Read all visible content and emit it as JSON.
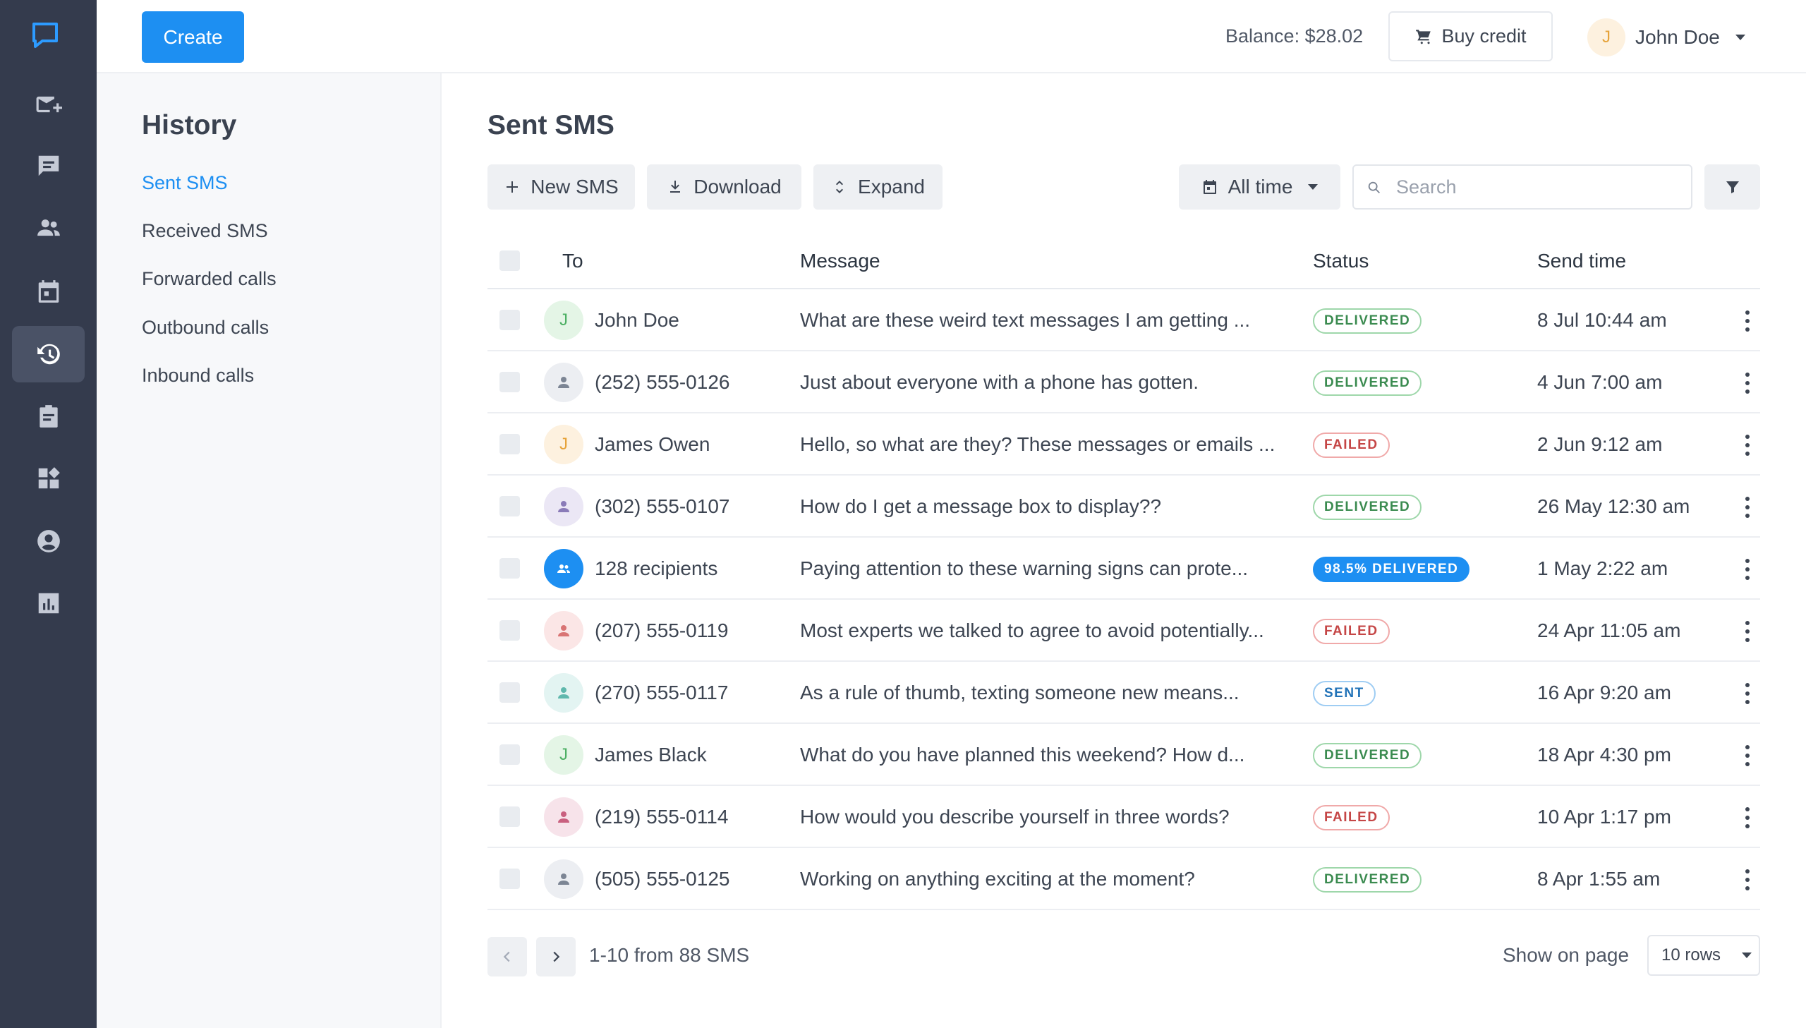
{
  "topbar": {
    "create_label": "Create",
    "balance": "Balance: $28.02",
    "buy_credit_label": "Buy credit",
    "user_initial": "J",
    "user_name": "John Doe"
  },
  "rail": {
    "items": [
      "compose-mail-icon",
      "chat-icon",
      "contacts-icon",
      "calendar-icon",
      "history-icon",
      "clipboard-icon",
      "widgets-icon",
      "account-icon",
      "reports-icon"
    ],
    "active": "history-icon"
  },
  "sidebar": {
    "title": "History",
    "items": [
      {
        "label": "Sent SMS",
        "active": true
      },
      {
        "label": "Received SMS",
        "active": false
      },
      {
        "label": "Forwarded calls",
        "active": false
      },
      {
        "label": "Outbound calls",
        "active": false
      },
      {
        "label": "Inbound calls",
        "active": false
      }
    ]
  },
  "main": {
    "title": "Sent SMS",
    "toolbar": {
      "new_sms_label": "New SMS",
      "download_label": "Download",
      "expand_label": "Expand",
      "time_filter_label": "All time",
      "search_placeholder": "Search"
    },
    "table": {
      "headers": {
        "to": "To",
        "message": "Message",
        "status": "Status",
        "send_time": "Send time"
      },
      "rows": [
        {
          "to": "John Doe",
          "avatar": "J",
          "avatar_style": "green",
          "message": "What are these weird text messages I am getting ...",
          "status": "DELIVERED",
          "status_type": "delivered",
          "time": "8 Jul 10:44 am"
        },
        {
          "to": "(252) 555-0126",
          "avatar": "person-icon",
          "avatar_style": "gray",
          "message": "Just about everyone with a phone has gotten.",
          "status": "DELIVERED",
          "status_type": "delivered",
          "time": "4 Jun 7:00 am"
        },
        {
          "to": "James Owen",
          "avatar": "J",
          "avatar_style": "orange",
          "message": "Hello, so what are they? These messages or emails ...",
          "status": "FAILED",
          "status_type": "failed",
          "time": "2 Jun 9:12 am"
        },
        {
          "to": "(302) 555-0107",
          "avatar": "person-icon",
          "avatar_style": "purple",
          "message": "How do I get a message box to display??",
          "status": "DELIVERED",
          "status_type": "delivered",
          "time": "26 May 12:30 am"
        },
        {
          "to": "128 recipients",
          "avatar": "group-icon",
          "avatar_style": "blue",
          "message": "Paying attention to these warning signs can prote...",
          "status": "98.5% DELIVERED",
          "status_type": "partial",
          "time": "1 May 2:22 am"
        },
        {
          "to": "(207) 555-0119",
          "avatar": "person-icon",
          "avatar_style": "red",
          "message": "Most experts we talked to agree to avoid potentially...",
          "status": "FAILED",
          "status_type": "failed",
          "time": "24 Apr 11:05 am"
        },
        {
          "to": "(270) 555-0117",
          "avatar": "person-icon",
          "avatar_style": "teal",
          "message": "As a rule of thumb, texting someone new means...",
          "status": "SENT",
          "status_type": "sent",
          "time": "16 Apr 9:20 am"
        },
        {
          "to": "James Black",
          "avatar": "J",
          "avatar_style": "green",
          "message": "What do you have planned this weekend? How d...",
          "status": "DELIVERED",
          "status_type": "delivered",
          "time": "18 Apr 4:30 pm"
        },
        {
          "to": "(219) 555-0114",
          "avatar": "person-icon",
          "avatar_style": "pink",
          "message": "How would you describe yourself in three words?",
          "status": "FAILED",
          "status_type": "failed",
          "time": "10 Apr 1:17 pm"
        },
        {
          "to": "(505) 555-0125",
          "avatar": "person-icon",
          "avatar_style": "gray",
          "message": "Working on anything exciting at the moment?",
          "status": "DELIVERED",
          "status_type": "delivered",
          "time": "8 Apr 1:55 am"
        }
      ]
    },
    "pagination": {
      "info": "1-10 from 88 SMS",
      "show_label": "Show on page",
      "rows_value": "10 rows"
    }
  },
  "colors": {
    "accent": "#1d8ff2",
    "rail_bg": "#343b4d",
    "delivered": "#3b8b50",
    "failed": "#c54646",
    "sent": "#2273b8"
  }
}
